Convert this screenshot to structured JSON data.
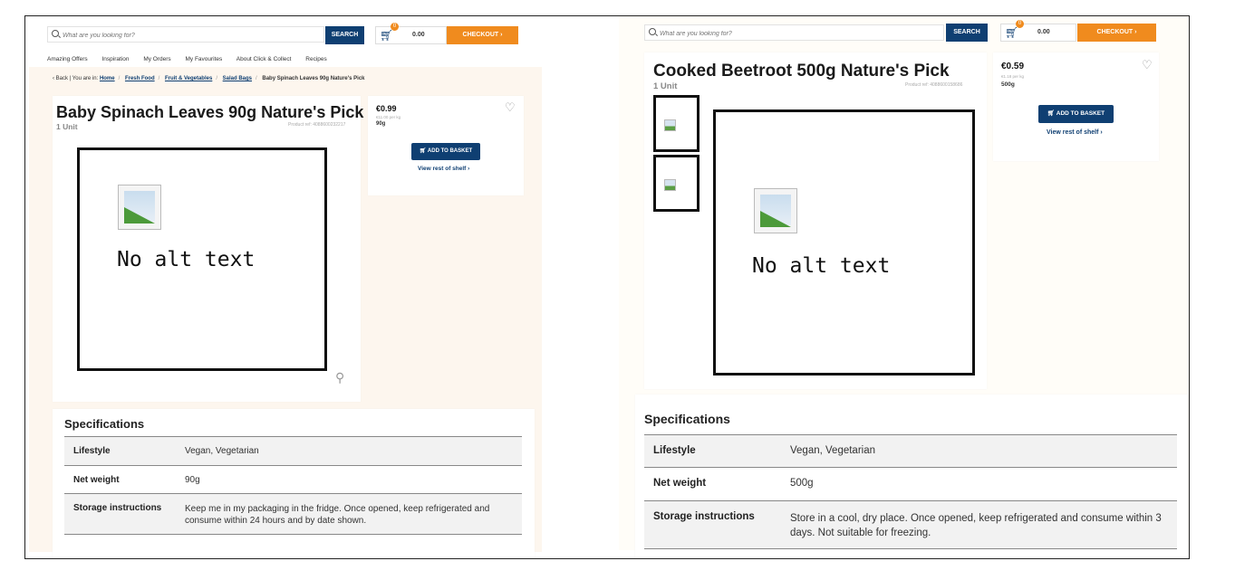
{
  "header": {
    "search_placeholder": "What are you looking for?",
    "search_button": "SEARCH",
    "cart_count": "0",
    "cart_total": "0.00",
    "checkout_button": "CHECKOUT",
    "cart_icon": "cart-icon",
    "search_icon": "search-icon"
  },
  "nav": {
    "items": [
      "Amazing Offers",
      "Inspiration",
      "My Orders",
      "My Favourites",
      "About Click & Collect",
      "Recipes"
    ]
  },
  "breadcrumb": {
    "back": "‹ Back | You are in:",
    "links": [
      "Home",
      "Fresh Food",
      "Fruit & Vegetables",
      "Salad Bags"
    ],
    "current": "Baby Spinach Leaves 90g Nature's Pick"
  },
  "left_product": {
    "title": "Baby Spinach Leaves 90g Nature's Pick",
    "unit": "1 Unit",
    "product_ref": "Product ref: 4088600232217",
    "alt_text": "No alt text",
    "price": "€0.99",
    "price_per_kg": "€11.00 per kg",
    "weight": "90g",
    "add_button": "ADD TO BASKET",
    "view_shelf": "View rest of shelf",
    "specs_title": "Specifications",
    "specs": [
      {
        "key": "Lifestyle",
        "value": "Vegan, Vegetarian"
      },
      {
        "key": "Net weight",
        "value": "90g"
      },
      {
        "key": "Storage instructions",
        "value": "Keep me in my packaging in the fridge. Once opened, keep refrigerated and consume within 24 hours and by date shown."
      }
    ]
  },
  "right_product": {
    "title": "Cooked Beetroot 500g Nature's Pick",
    "unit": "1 Unit",
    "product_ref": "Product ref: 4088600158686",
    "alt_text": "No alt text",
    "price": "€0.59",
    "price_per_kg": "€1.18 per kg",
    "weight": "500g",
    "add_button": "ADD TO BASKET",
    "view_shelf": "View rest of shelf",
    "specs_title": "Specifications",
    "specs": [
      {
        "key": "Lifestyle",
        "value": "Vegan, Vegetarian"
      },
      {
        "key": "Net weight",
        "value": "500g"
      },
      {
        "key": "Storage instructions",
        "value": "Store in a cool, dry place. Once opened, keep refrigerated and consume within 3 days. Not suitable for freezing."
      }
    ]
  },
  "colors": {
    "brand_blue": "#0f3f72",
    "checkout_orange": "#f08b1e",
    "page_bg": "#fdf6ee"
  }
}
